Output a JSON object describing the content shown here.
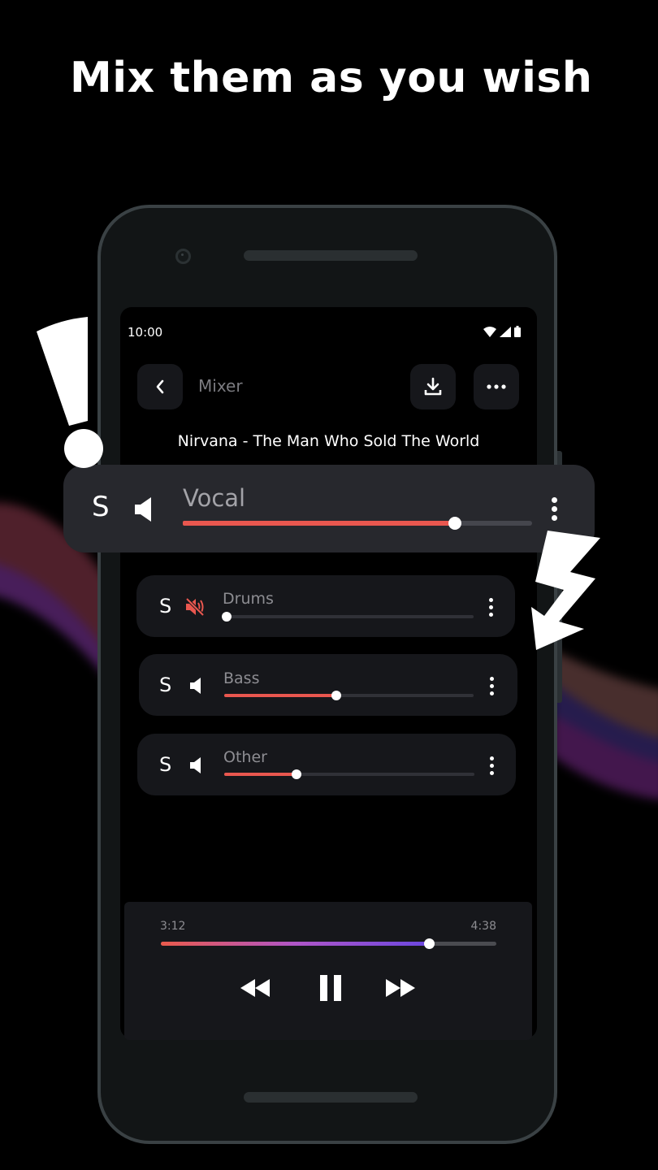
{
  "promo": {
    "headline": "Mix them as you wish"
  },
  "status_bar": {
    "time": "10:00",
    "icons": [
      "wifi-icon",
      "signal-icon",
      "battery-icon"
    ]
  },
  "header": {
    "back_icon": "chevron-left-icon",
    "title": "Mixer",
    "download_icon": "download-icon",
    "more_icon": "more-horizontal-icon"
  },
  "song": {
    "title": "Nirvana - The Man Who Sold The World"
  },
  "tracks": [
    {
      "solo_label": "S",
      "name": "Vocal",
      "muted": false,
      "volume_percent": 78,
      "highlighted": true
    },
    {
      "solo_label": "S",
      "name": "Drums",
      "muted": true,
      "volume_percent": 0,
      "highlighted": false
    },
    {
      "solo_label": "S",
      "name": "Bass",
      "muted": false,
      "volume_percent": 45,
      "highlighted": false
    },
    {
      "solo_label": "S",
      "name": "Other",
      "muted": false,
      "volume_percent": 29,
      "highlighted": false
    }
  ],
  "player": {
    "elapsed": "3:12",
    "duration": "4:38",
    "progress_percent": 80,
    "controls": [
      "rewind-icon",
      "pause-icon",
      "fast-forward-icon"
    ]
  },
  "colors": {
    "accent": "#e9574f",
    "muted_icon": "#e9574f",
    "progress_gradient_start": "#ea5a4c",
    "progress_gradient_end": "#6b47e0",
    "card_bg": "#16171b",
    "highlight_card_bg": "#27282d"
  }
}
